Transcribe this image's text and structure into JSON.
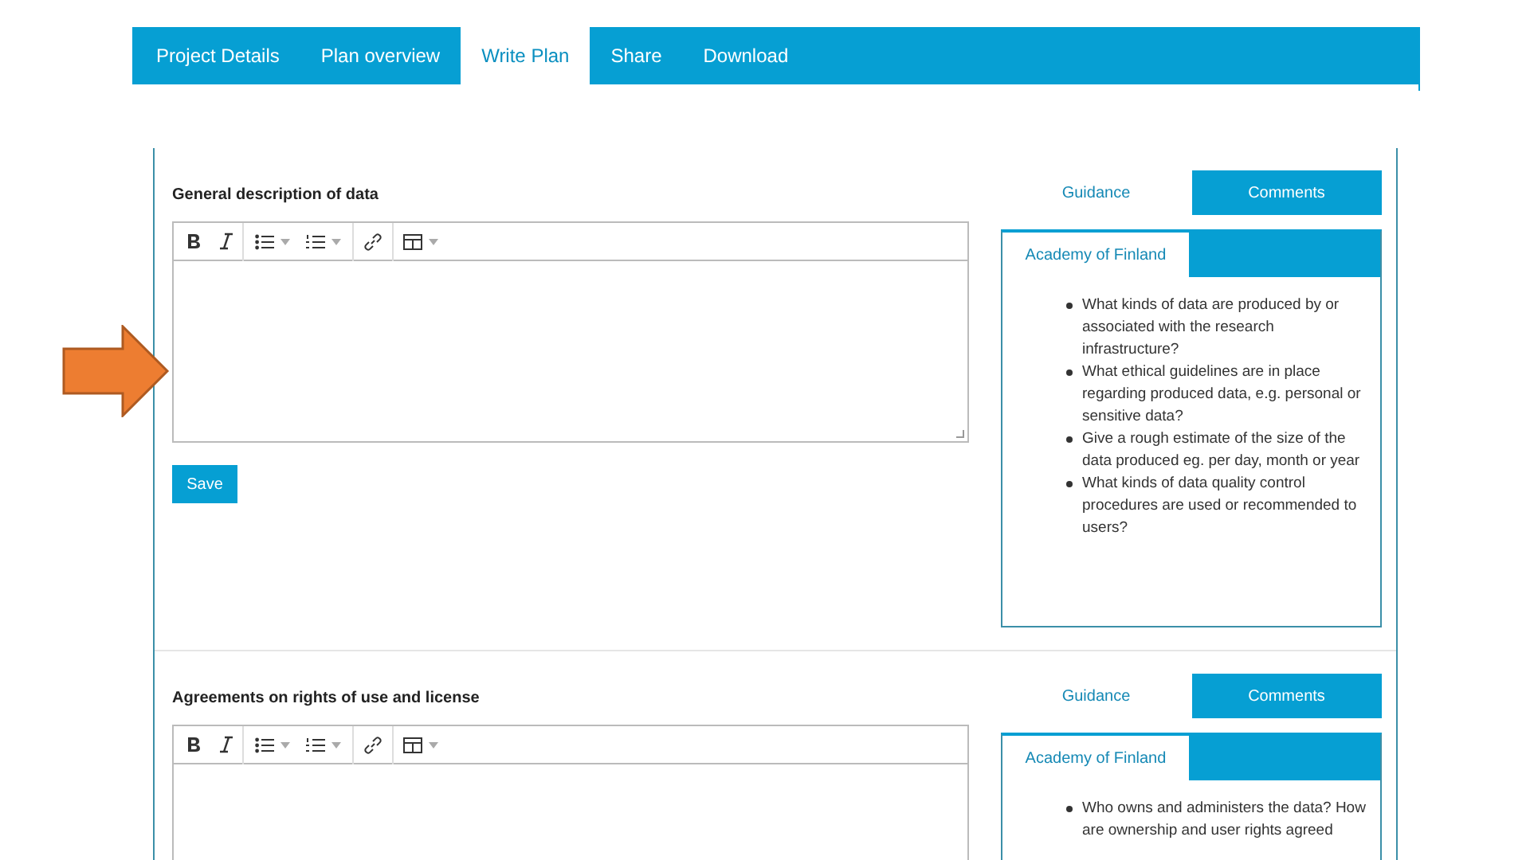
{
  "nav_tabs": [
    {
      "label": "Project Details",
      "selected": false
    },
    {
      "label": "Plan overview",
      "selected": false
    },
    {
      "label": "Write Plan",
      "selected": true
    },
    {
      "label": "Share",
      "selected": false
    },
    {
      "label": "Download",
      "selected": false
    }
  ],
  "sections": [
    {
      "title": "General description of data",
      "save": "Save",
      "side_tabs": [
        {
          "label": "Guidance",
          "selected": true
        },
        {
          "label": "Comments",
          "selected": false
        }
      ],
      "org_tab": {
        "label": "Academy of Finland",
        "selected": true
      },
      "questions": [
        "What kinds of data are produced by or associated with the research infrastructure?",
        "What ethical guidelines are in place regarding produced data, e.g. personal or sensitive data?",
        "Give a rough estimate of the size of the data produced eg. per day, month or year",
        "What kinds of data quality control procedures are used or recommended to users?"
      ]
    },
    {
      "title": "Agreements on rights of use and license",
      "side_tabs": [
        {
          "label": "Guidance",
          "selected": true
        },
        {
          "label": "Comments",
          "selected": false
        }
      ],
      "org_tab": {
        "label": "Academy of Finland",
        "selected": true
      },
      "questions": [
        "Who owns and administers the data? How are ownership and user rights agreed"
      ]
    }
  ]
}
